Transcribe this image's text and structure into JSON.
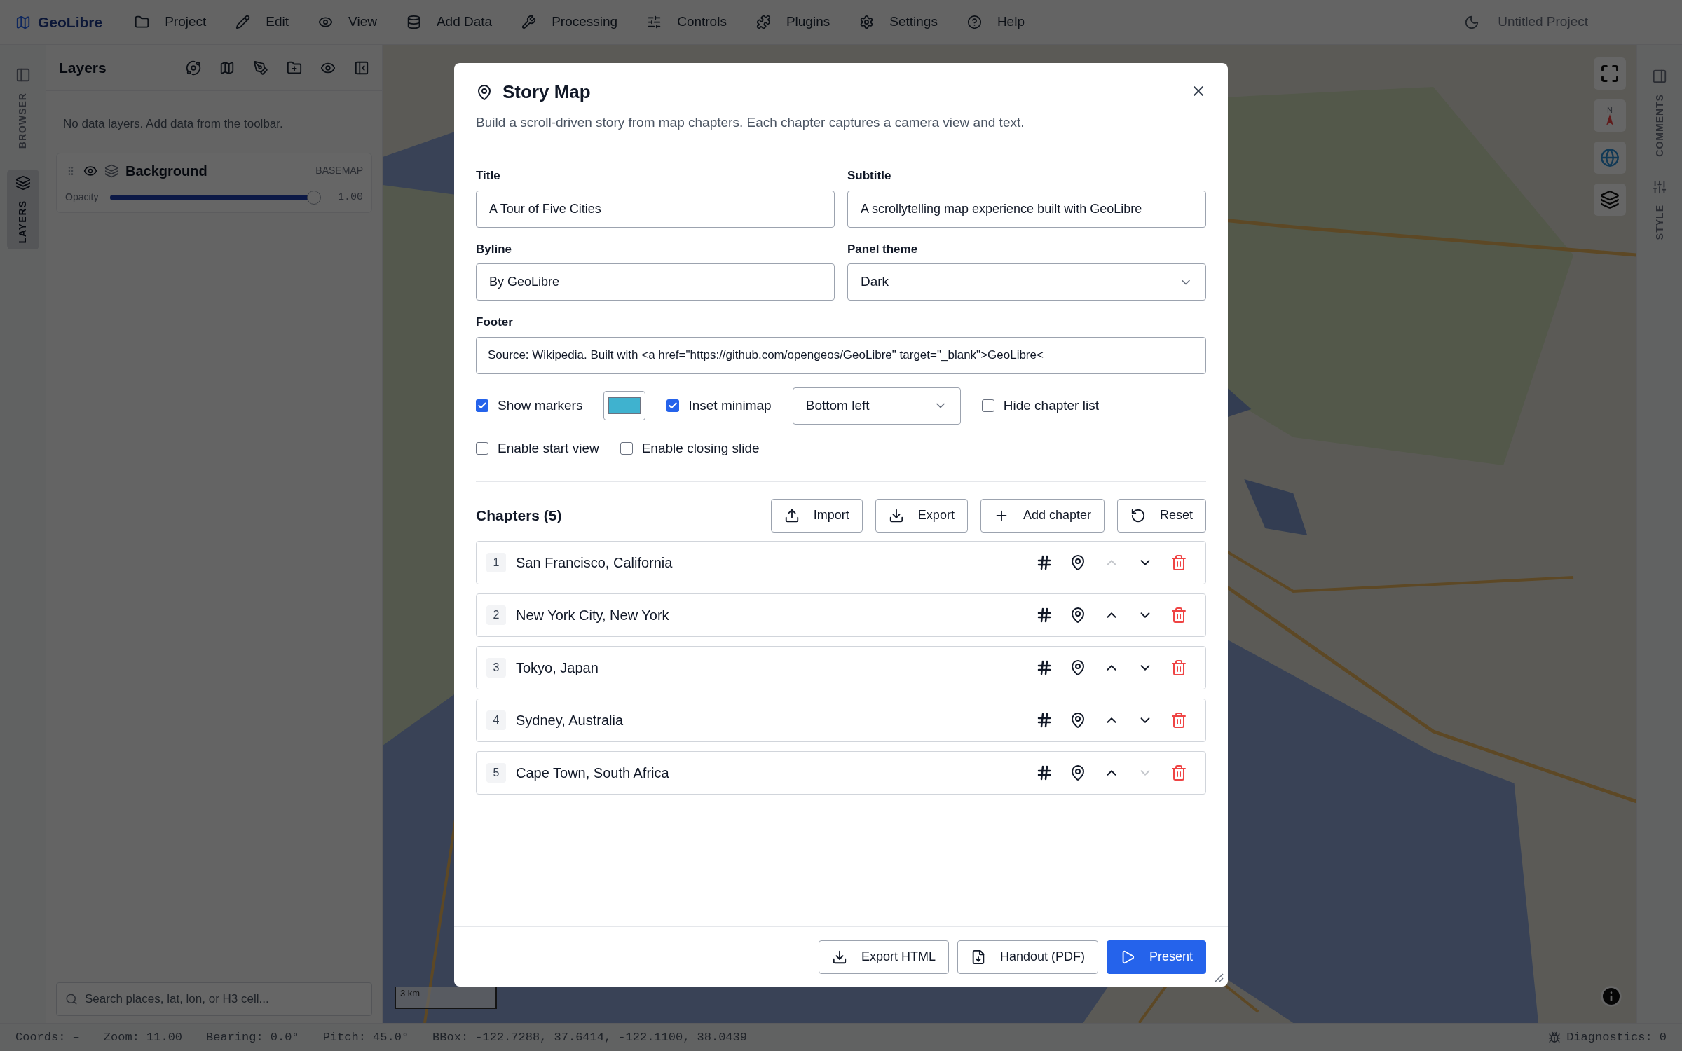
{
  "menubar": {
    "app_name": "GeoLibre",
    "menus": [
      "Project",
      "Edit",
      "View",
      "Add Data",
      "Processing",
      "Controls",
      "Plugins",
      "Settings",
      "Help"
    ],
    "project_name": "Untitled Project"
  },
  "left_rail": {
    "tabs": [
      {
        "label": "BROWSER",
        "selected": false
      },
      {
        "label": "LAYERS",
        "selected": true
      }
    ]
  },
  "layers_panel": {
    "title": "Layers",
    "empty_message": "No data layers. Add data from the toolbar.",
    "layers": [
      {
        "name": "Background",
        "type": "BASEMAP",
        "visible": true,
        "opacity_label": "Opacity",
        "level": 0.99,
        "reading": "1.00"
      }
    ],
    "search": {
      "placeholder": "Search places, lat, lon, or H3 cell..."
    }
  },
  "map": {
    "compass_label": "N",
    "scale": "3 km"
  },
  "right_rail": {
    "tabs": [
      {
        "label": "COMMENTS",
        "selected": false
      },
      {
        "label": "STYLE",
        "selected": false
      }
    ]
  },
  "status_bar": {
    "items": [
      "Coords: –",
      "Zoom: 11.00",
      "Bearing: 0.0°",
      "Pitch: 45.0°",
      "BBox: -122.7288, 37.6414, -122.1100, 38.0439"
    ],
    "diagnostics": "Diagnostics: 0"
  },
  "dialog": {
    "title": "Story Map",
    "description": "Build a scroll-driven story from map chapters. Each chapter captures a camera view and text.",
    "fields": [
      {
        "label": "Title",
        "value": "A Tour of Five Cities",
        "kind": "text"
      },
      {
        "label": "Subtitle",
        "value": "A scrollytelling map experience built with GeoLibre",
        "kind": "text"
      },
      {
        "label": "Byline",
        "value": "By GeoLibre",
        "kind": "text"
      },
      {
        "label": "Panel theme",
        "value": "Dark",
        "kind": "select"
      }
    ],
    "footer_field": {
      "label": "Footer",
      "value": "Source: Wikipedia. Built with <a href=\"https://github.com/opengeos/GeoLibre\" target=\"_blank\">GeoLibre<"
    },
    "option_rows": [
      [
        {
          "kind": "checkbox",
          "label": "Show markers",
          "checked": true
        },
        {
          "kind": "swatch",
          "color": "#3fb2cf"
        },
        {
          "kind": "checkbox",
          "label": "Inset minimap",
          "checked": true
        },
        {
          "kind": "select",
          "value": "Bottom left"
        },
        {
          "kind": "checkbox",
          "label": "Hide chapter list",
          "checked": false
        }
      ],
      [
        {
          "kind": "checkbox",
          "label": "Enable start view",
          "checked": false
        },
        {
          "kind": "checkbox",
          "label": "Enable closing slide",
          "checked": false
        }
      ]
    ],
    "chapters": {
      "title": "Chapters (5)",
      "actions": [
        "Import",
        "Export",
        "Add chapter",
        "Reset"
      ],
      "items": [
        {
          "number": "1",
          "title": "San Francisco, California",
          "up_disabled": true,
          "down_disabled": false
        },
        {
          "number": "2",
          "title": "New York City, New York",
          "up_disabled": false,
          "down_disabled": false
        },
        {
          "number": "3",
          "title": "Tokyo, Japan",
          "up_disabled": false,
          "down_disabled": false
        },
        {
          "number": "4",
          "title": "Sydney, Australia",
          "up_disabled": false,
          "down_disabled": false
        },
        {
          "number": "5",
          "title": "Cape Town, South Africa",
          "up_disabled": false,
          "down_disabled": true
        }
      ]
    },
    "buttons": [
      {
        "label": "Export HTML",
        "primary": false
      },
      {
        "label": "Handout (PDF)",
        "primary": false
      },
      {
        "label": "Present",
        "primary": true
      }
    ]
  }
}
